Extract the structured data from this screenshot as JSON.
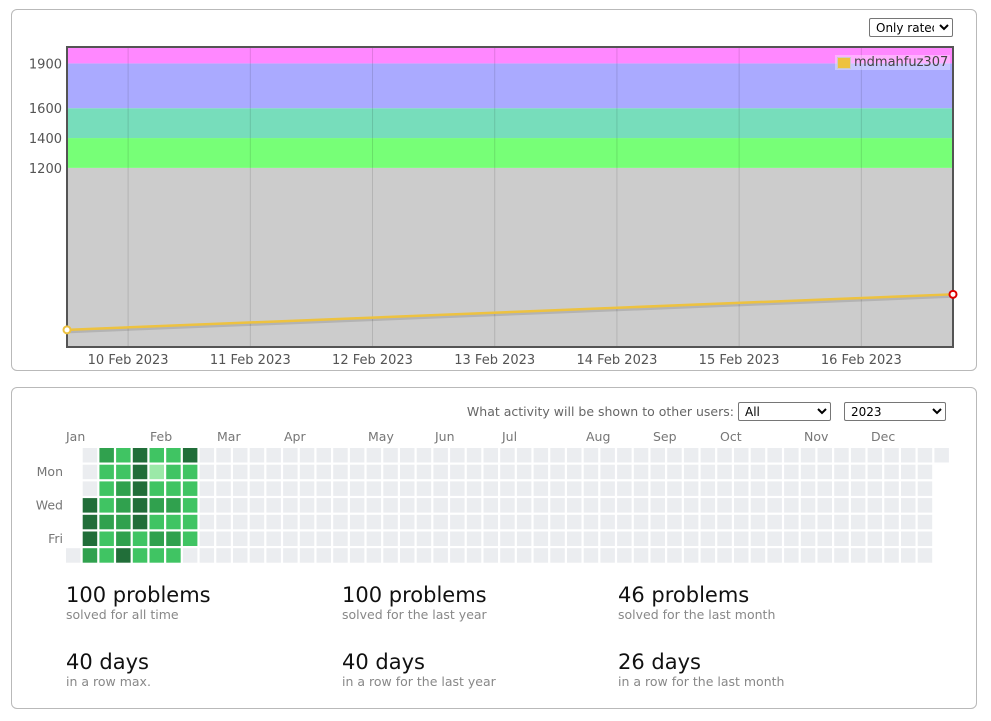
{
  "rating": {
    "filter": {
      "selected": "Only rated"
    },
    "legend": [
      {
        "name": "mdmahfuz307",
        "color": "#edc240"
      }
    ],
    "bands": [
      {
        "from": 0,
        "to": 1200,
        "color": "#cccccc"
      },
      {
        "from": 1200,
        "to": 1400,
        "color": "#77ff77"
      },
      {
        "from": 1400,
        "to": 1600,
        "color": "#77ddbb"
      },
      {
        "from": 1600,
        "to": 1900,
        "color": "#aaaaff"
      },
      {
        "from": 1900,
        "to": 2100,
        "color": "#ff88ff"
      }
    ]
  },
  "chart_data": {
    "type": "line",
    "title": "",
    "xlabel": "",
    "ylabel": "",
    "x_ticks": [
      "10 Feb 2023",
      "11 Feb 2023",
      "12 Feb 2023",
      "13 Feb 2023",
      "14 Feb 2023",
      "15 Feb 2023",
      "16 Feb 2023"
    ],
    "y_ticks": [
      1200,
      1400,
      1600,
      1900
    ],
    "xlim": [
      "2023-02-09 12:00",
      "2023-02-16 18:00"
    ],
    "ylim": [
      0,
      2010
    ],
    "grid": true,
    "legend_position": "top-right",
    "series": [
      {
        "name": "mdmahfuz307",
        "color": "#edc240",
        "points": [
          {
            "x": "2023-02-09 12:00",
            "y": 115
          },
          {
            "x": "2023-02-16 18:00",
            "y": 353
          }
        ]
      }
    ]
  },
  "activity": {
    "visibility_label": "What activity will be shown to other users:",
    "visibility_selected": "All",
    "year_selected": "2023",
    "months": [
      "Jan",
      "Feb",
      "Mar",
      "Apr",
      "May",
      "Jun",
      "Jul",
      "Aug",
      "Sep",
      "Oct",
      "Nov",
      "Dec"
    ],
    "weekdays": [
      "Mon",
      "Wed",
      "Fri"
    ],
    "colors": {
      "0": "#ebedf0",
      "1": "#9be9a8",
      "2": "#40c463",
      "3": "#30a14e",
      "4": "#216e39"
    },
    "weeks": [
      [
        -1,
        -1,
        -1,
        -1,
        -1,
        -1,
        0
      ],
      [
        0,
        0,
        0,
        4,
        4,
        4,
        3
      ],
      [
        3,
        2,
        2,
        2,
        3,
        2,
        2
      ],
      [
        2,
        2,
        3,
        3,
        3,
        3,
        4
      ],
      [
        4,
        4,
        4,
        4,
        4,
        2,
        2
      ],
      [
        2,
        1,
        2,
        3,
        2,
        3,
        2
      ],
      [
        2,
        2,
        2,
        3,
        2,
        3,
        2
      ],
      [
        4,
        2,
        2,
        2,
        2,
        2,
        0
      ],
      [
        0,
        0,
        0,
        0,
        0,
        0,
        0
      ]
    ],
    "total_weeks": 53,
    "last_week_days": 1,
    "stats": [
      {
        "value": "100 problems",
        "label": "solved for all time"
      },
      {
        "value": "100 problems",
        "label": "solved for the last year"
      },
      {
        "value": "46 problems",
        "label": "solved for the last month"
      },
      {
        "value": "40 days",
        "label": "in a row max."
      },
      {
        "value": "40 days",
        "label": "in a row for the last year"
      },
      {
        "value": "26 days",
        "label": "in a row for the last month"
      }
    ]
  }
}
